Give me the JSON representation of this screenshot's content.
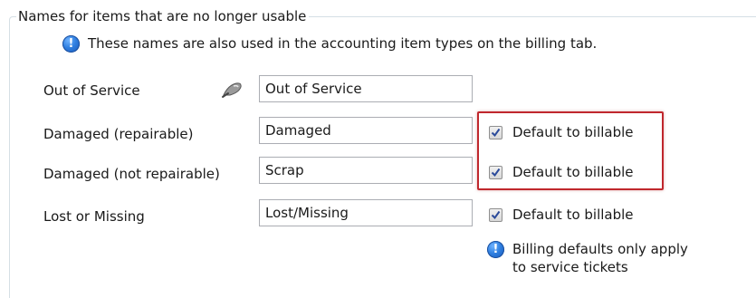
{
  "group": {
    "legend": "Names for items that are no longer usable"
  },
  "info_banner": {
    "icon": "info-icon",
    "text": "These names are also used in the accounting item types on the billing tab."
  },
  "rows": [
    {
      "label": "Out of Service",
      "value": "Out of Service",
      "has_checkbox": false,
      "icon": "pen-icon"
    },
    {
      "label": "Damaged (repairable)",
      "value": "Damaged",
      "has_checkbox": true,
      "checked": true,
      "checkbox_label": "Default to billable"
    },
    {
      "label": "Damaged (not repairable)",
      "value": "Scrap",
      "has_checkbox": true,
      "checked": true,
      "checkbox_label": "Default to billable"
    },
    {
      "label": "Lost or Missing",
      "value": "Lost/Missing",
      "has_checkbox": true,
      "checked": true,
      "checkbox_label": "Default to billable"
    }
  ],
  "billing_note": {
    "icon": "info-icon",
    "line1": "Billing defaults only apply",
    "line2": "to service tickets"
  },
  "colors": {
    "highlight_border": "#c0272d",
    "info_icon": "#2f7fe0",
    "checkmark": "#2a4a9a"
  }
}
